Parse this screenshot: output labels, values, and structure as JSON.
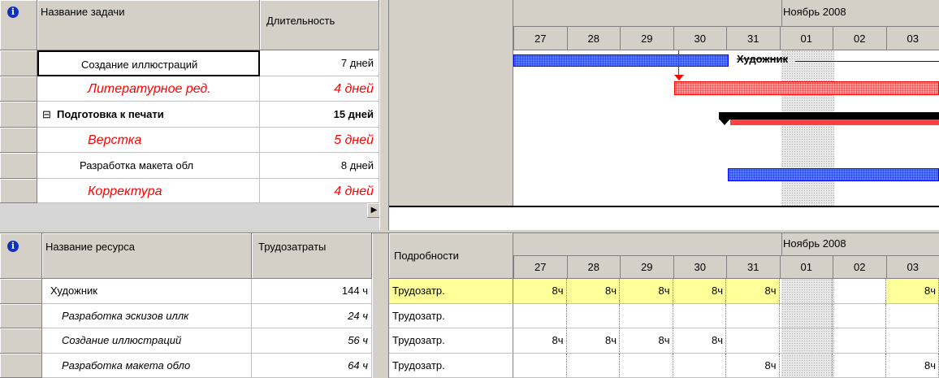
{
  "task_table": {
    "col_task": "Название задачи",
    "col_duration": "Длительность",
    "rows": [
      {
        "name": "Создание иллюстраций",
        "duration": "7 дней",
        "style": "normal"
      },
      {
        "name": "Литературное ред.",
        "duration": "4 дней",
        "style": "critical"
      },
      {
        "name": "Подготовка к печати",
        "duration": "15 дней",
        "style": "summary",
        "toggle": "⊟"
      },
      {
        "name": "Верстка",
        "duration": "5 дней",
        "style": "critical"
      },
      {
        "name": "Разработка макета обл",
        "duration": "8 дней",
        "style": "normal"
      },
      {
        "name": "Корректура",
        "duration": "4 дней",
        "style": "critical"
      }
    ]
  },
  "gantt": {
    "month_label": "Ноябрь 2008",
    "days": [
      "27",
      "28",
      "29",
      "30",
      "31",
      "01",
      "02",
      "03"
    ],
    "resource_label": "Художник",
    "colors": {
      "task_bar": "#5a7cff",
      "critical_bar": "#ff9a9a",
      "summary_bar": "#000000"
    }
  },
  "resource_table": {
    "col_resource": "Название ресурса",
    "col_work": "Трудозатраты",
    "rows": [
      {
        "name": "Художник",
        "work": "144 ч",
        "italic": false
      },
      {
        "name": "Разработка эскизов иллк",
        "work": "24 ч",
        "italic": true
      },
      {
        "name": "Создание иллюстраций",
        "work": "56 ч",
        "italic": true
      },
      {
        "name": "Разработка макета обло",
        "work": "64 ч",
        "italic": true
      }
    ]
  },
  "usage": {
    "details_label": "Подробности",
    "month_label": "Ноябрь 2008",
    "days": [
      "27",
      "28",
      "29",
      "30",
      "31",
      "01",
      "02",
      "03"
    ],
    "row_label": "Трудозатр.",
    "rows": [
      [
        "8ч",
        "8ч",
        "8ч",
        "8ч",
        "8ч",
        "",
        "",
        "8ч"
      ],
      [
        "",
        "",
        "",
        "",
        "",
        "",
        "",
        ""
      ],
      [
        "8ч",
        "8ч",
        "8ч",
        "8ч",
        "",
        "",
        "",
        ""
      ],
      [
        "",
        "",
        "",
        "",
        "8ч",
        "",
        "",
        "8ч"
      ]
    ]
  }
}
